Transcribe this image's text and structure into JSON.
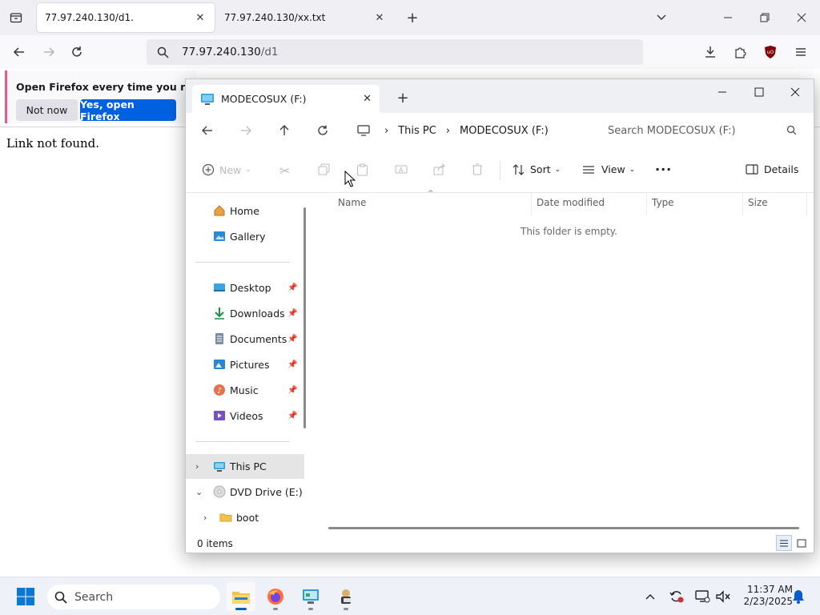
{
  "firefox": {
    "tabs": [
      {
        "title": "77.97.240.130/d1.",
        "active": true
      },
      {
        "title": "77.97.240.130/xx.txt",
        "active": false
      }
    ],
    "url": {
      "host": "77.97.240.130",
      "path": "/d1"
    },
    "notification": {
      "message": "Open Firefox every time you restart yo",
      "not_now": "Not now",
      "yes": "Yes, open Firefox"
    },
    "page_text": "Link not found."
  },
  "explorer": {
    "tab_title": "MODECOSUX (F:)",
    "breadcrumb": [
      "This PC",
      "MODECOSUX (F:)"
    ],
    "search_placeholder": "Search MODECOSUX (F:)",
    "toolbar": {
      "new": "New",
      "sort": "Sort",
      "view": "View",
      "details": "Details"
    },
    "nav_items": [
      {
        "label": "Home",
        "icon": "home-icon"
      },
      {
        "label": "Gallery",
        "icon": "gallery-icon"
      },
      {
        "label": "Desktop",
        "icon": "desktop-icon",
        "pinned": true
      },
      {
        "label": "Downloads",
        "icon": "downloads-icon",
        "pinned": true
      },
      {
        "label": "Documents",
        "icon": "documents-icon",
        "pinned": true
      },
      {
        "label": "Pictures",
        "icon": "pictures-icon",
        "pinned": true
      },
      {
        "label": "Music",
        "icon": "music-icon",
        "pinned": true
      },
      {
        "label": "Videos",
        "icon": "videos-icon",
        "pinned": true
      },
      {
        "label": "This PC",
        "icon": "pc-icon",
        "selected": true
      },
      {
        "label": "DVD Drive (E:) C",
        "icon": "dvd-icon",
        "expanded": true
      },
      {
        "label": "boot",
        "icon": "folder-icon"
      }
    ],
    "columns": [
      "Name",
      "Date modified",
      "Type",
      "Size"
    ],
    "empty_message": "This folder is empty.",
    "status": "0 items"
  },
  "taskbar": {
    "search_label": "Search",
    "time": "11:37 AM",
    "date": "2/23/2025"
  },
  "colors": {
    "accent": "#0061e0",
    "selection": "#e5e5e5",
    "taskbar": "#eef2f8"
  }
}
